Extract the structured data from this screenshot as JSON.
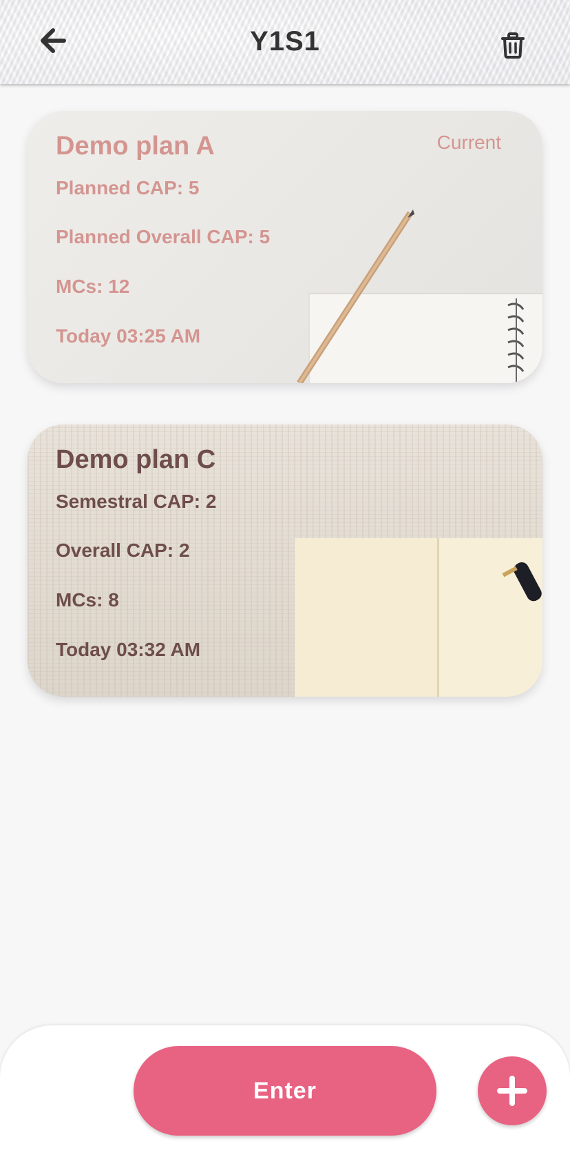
{
  "header": {
    "title": "Y1S1",
    "back_icon": "arrow-left-icon",
    "delete_icon": "trash-icon"
  },
  "plans": [
    {
      "name": "Demo plan A",
      "tag": "Current",
      "stats": [
        "Planned CAP: 5",
        "Planned Overall CAP: 5",
        "MCs: 12",
        "Today 03:25 AM"
      ],
      "text_color": "#d49591"
    },
    {
      "name": "Demo plan C",
      "stats": [
        "Semestral CAP: 2",
        "Overall CAP: 2",
        "MCs: 8",
        "Today 03:32 AM"
      ],
      "text_color": "#6e4d4b"
    }
  ],
  "footer": {
    "enter_label": "Enter",
    "add_icon": "plus-icon",
    "accent_color": "#e86282"
  }
}
